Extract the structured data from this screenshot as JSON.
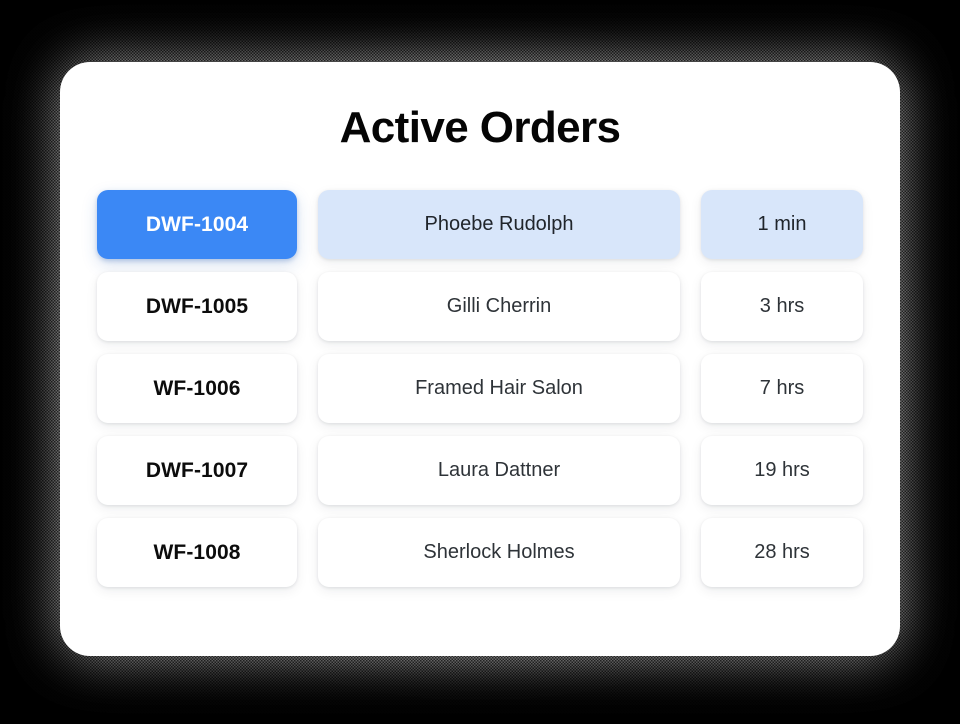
{
  "card": {
    "title": "Active Orders",
    "accent_color": "#3b88f5",
    "selected_row_tint": "#d8e6fa",
    "background_color": "#ffffff",
    "page_background_color": "#000000"
  },
  "orders": [
    {
      "id": "DWF-1004",
      "customer": "Phoebe Rudolph",
      "elapsed": "1 min",
      "selected": true
    },
    {
      "id": "DWF-1005",
      "customer": "Gilli Cherrin",
      "elapsed": "3 hrs",
      "selected": false
    },
    {
      "id": "WF-1006",
      "customer": "Framed Hair Salon",
      "elapsed": "7 hrs",
      "selected": false
    },
    {
      "id": "DWF-1007",
      "customer": "Laura Dattner",
      "elapsed": "19 hrs",
      "selected": false
    },
    {
      "id": "WF-1008",
      "customer": "Sherlock Holmes",
      "elapsed": "28 hrs",
      "selected": false
    }
  ]
}
